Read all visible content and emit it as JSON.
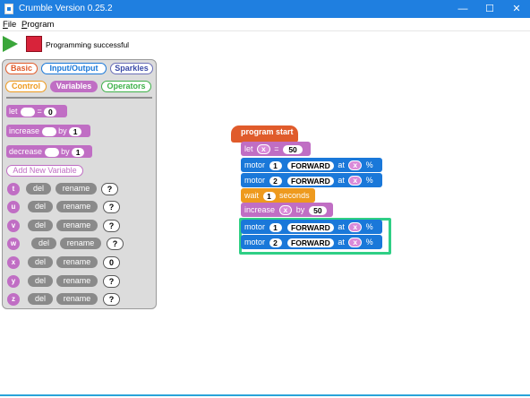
{
  "window": {
    "title": "Crumble Version 0.25.2",
    "minimize": "—",
    "maximize": "☐",
    "close": "✕"
  },
  "menu": {
    "file": "File",
    "program": "Program"
  },
  "toolbar": {
    "status": "Programming successful"
  },
  "palette": {
    "categories": {
      "basic": "Basic",
      "io": "Input/Output",
      "sparkles": "Sparkles",
      "control": "Control",
      "variables": "Variables",
      "operators": "Operators"
    },
    "blocks": {
      "let_label": "let",
      "let_eq": "=",
      "let_value": "0",
      "increase_label": "increase",
      "increase_by": "by",
      "increase_value": "1",
      "decrease_label": "decrease",
      "decrease_by": "by",
      "decrease_value": "1"
    },
    "add_variable": "Add New Variable",
    "del_label": "del",
    "rename_label": "rename",
    "variables": [
      {
        "name": "t",
        "value": "?"
      },
      {
        "name": "u",
        "value": "?"
      },
      {
        "name": "v",
        "value": "?"
      },
      {
        "name": "w",
        "value": "?"
      },
      {
        "name": "x",
        "value": "0"
      },
      {
        "name": "y",
        "value": "?"
      },
      {
        "name": "z",
        "value": "?"
      }
    ]
  },
  "program": {
    "start": "program start",
    "let": {
      "label": "let",
      "var": "x",
      "eq": "=",
      "value": "50"
    },
    "motor1": {
      "label": "motor",
      "num": "1",
      "dir": "FORWARD",
      "at": "at",
      "var": "x",
      "unit": "%"
    },
    "motor2": {
      "label": "motor",
      "num": "2",
      "dir": "FORWARD",
      "at": "at",
      "var": "x",
      "unit": "%"
    },
    "wait": {
      "label": "wait",
      "value": "1",
      "unit": "seconds"
    },
    "increase": {
      "label": "increase",
      "var": "x",
      "by": "by",
      "value": "50"
    },
    "motor3": {
      "label": "motor",
      "num": "1",
      "dir": "FORWARD",
      "at": "at",
      "var": "x",
      "unit": "%"
    },
    "motor4": {
      "label": "motor",
      "num": "2",
      "dir": "FORWARD",
      "at": "at",
      "var": "x",
      "unit": "%"
    }
  },
  "colors": {
    "titlebar": "#1f7fe0",
    "variables": "#c06ec4",
    "motion": "#1a78d9",
    "control": "#ee9a1e",
    "start": "#e05b2b",
    "highlight": "#2fcf85"
  }
}
